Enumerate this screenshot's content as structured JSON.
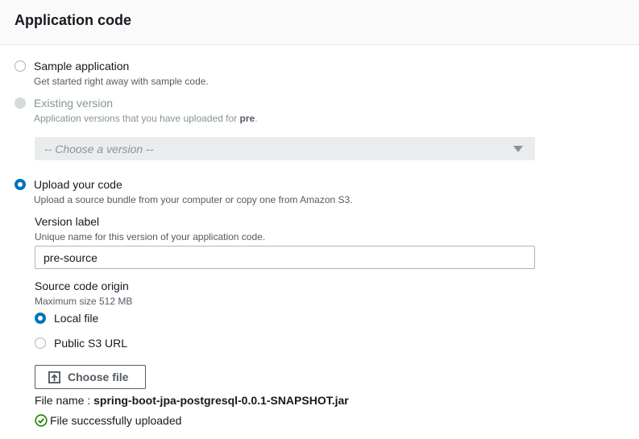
{
  "section": {
    "title": "Application code"
  },
  "options": {
    "sample": {
      "label": "Sample application",
      "description": "Get started right away with sample code."
    },
    "existing": {
      "label": "Existing version",
      "description_prefix": "Application versions that you have uploaded for ",
      "environment": "pre",
      "description_suffix": ".",
      "select_placeholder": "-- Choose a version --"
    },
    "upload": {
      "label": "Upload your code",
      "description": "Upload a source bundle from your computer or copy one from Amazon S3."
    }
  },
  "version_label": {
    "label": "Version label",
    "hint": "Unique name for this version of your application code.",
    "value": "pre-source"
  },
  "source_origin": {
    "label": "Source code origin",
    "hint": "Maximum size 512 MB",
    "options": {
      "local": "Local file",
      "s3": "Public S3 URL"
    }
  },
  "upload_control": {
    "button_label": "Choose file",
    "file_name_label": "File name :",
    "file_name": "spring-boot-jpa-postgresql-0.0.1-SNAPSHOT.jar",
    "status": "File successfully uploaded"
  },
  "colors": {
    "accent": "#0073bb",
    "success": "#1d8102",
    "disabled": "#879596"
  },
  "icons": {
    "upload": "upload-icon",
    "success": "check-circle-icon",
    "dropdown": "caret-down-icon"
  }
}
